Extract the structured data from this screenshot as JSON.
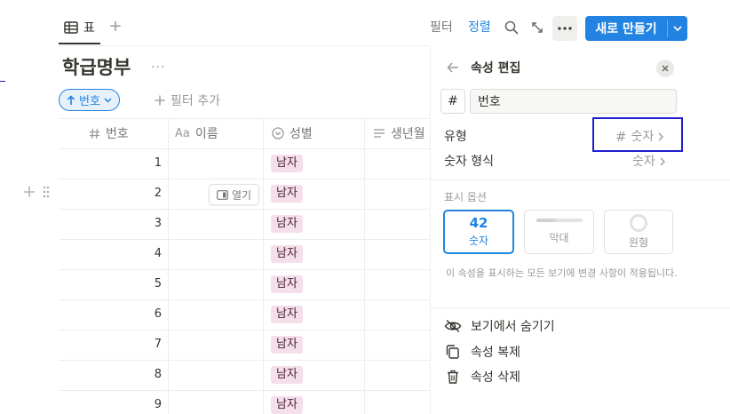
{
  "view_tab": {
    "label": "표",
    "add": "+"
  },
  "toolbar": {
    "filter": "필터",
    "sort": "정렬",
    "new_label": "새로 만들기"
  },
  "page": {
    "title": "학급명부",
    "more": "···"
  },
  "sort_chip": {
    "label": "번호"
  },
  "add_filter": {
    "label": "필터 추가"
  },
  "table": {
    "headers": [
      {
        "icon": "hash-icon",
        "label": "번호"
      },
      {
        "icon": "text-aa-icon",
        "prefix": "Aa",
        "label": "이름"
      },
      {
        "icon": "select-circle-icon",
        "label": "성별"
      },
      {
        "icon": "lines-icon",
        "label": "생년월"
      }
    ],
    "rows": [
      {
        "num": "1",
        "gender": "남자"
      },
      {
        "num": "2",
        "gender": "남자"
      },
      {
        "num": "3",
        "gender": "남자"
      },
      {
        "num": "4",
        "gender": "남자"
      },
      {
        "num": "5",
        "gender": "남자"
      },
      {
        "num": "6",
        "gender": "남자"
      },
      {
        "num": "7",
        "gender": "남자"
      },
      {
        "num": "8",
        "gender": "남자"
      },
      {
        "num": "9",
        "gender": "남자"
      }
    ],
    "open_label": "열기",
    "tag_color": "#f4dfeb"
  },
  "panel": {
    "title": "속성 편집",
    "type_symbol": "#",
    "name_value": "번호",
    "type_label": "유형",
    "type_value_symbol": "#",
    "type_value": "숫자",
    "format_label": "숫자 형식",
    "format_value": "숫자",
    "display_label": "표시 옵션",
    "display_options": [
      {
        "big": "42",
        "label": "숫자",
        "selected": true
      },
      {
        "label": "막대",
        "selected": false
      },
      {
        "label": "원형",
        "selected": false
      }
    ],
    "hint": "이 속성을 표시하는 모든 보기에 변경 사항이 적용됩니다.",
    "actions": [
      {
        "icon": "eye-off-icon",
        "label": "보기에서 숨기기"
      },
      {
        "icon": "duplicate-icon",
        "label": "속성 복제"
      },
      {
        "icon": "trash-icon",
        "label": "속성 삭제"
      }
    ]
  },
  "colors": {
    "accent": "#2383e2",
    "highlight": "#1f1fd0",
    "tag": "#f4dfeb"
  }
}
